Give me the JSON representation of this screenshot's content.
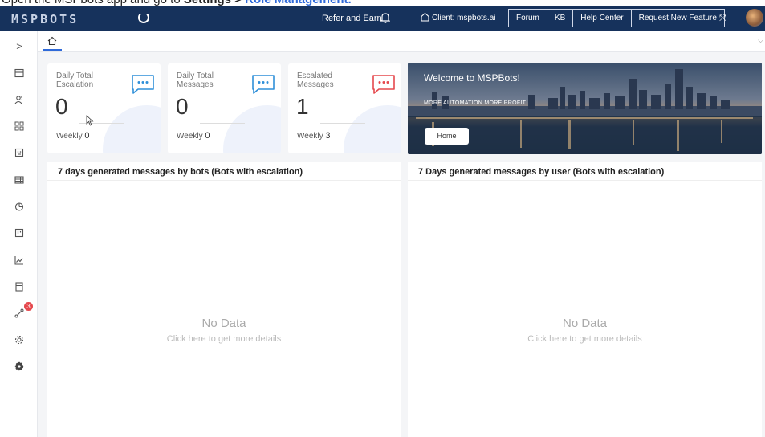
{
  "instruction": {
    "prefix": "Open the MSPbots app and go to ",
    "settings": "Settings",
    "separator": " > ",
    "target": "Role Management."
  },
  "topbar": {
    "logo": "MSPBOTS",
    "refer_label": "Refer and Earn",
    "client_label": "Client: mspbots.ai",
    "nav_buttons": [
      "Forum",
      "KB",
      "Help Center",
      "Request New Feature"
    ]
  },
  "sidebar": {
    "expand_glyph": ">",
    "badge_count": "3"
  },
  "stats": [
    {
      "label": "Daily Total Escalation",
      "value": "0",
      "weekly_label": "Weekly",
      "weekly_value": "0",
      "icon_color": "#2f8fd9"
    },
    {
      "label": "Daily Total Messages",
      "value": "0",
      "weekly_label": "Weekly",
      "weekly_value": "0",
      "icon_color": "#2f8fd9"
    },
    {
      "label": "Escalated Messages",
      "value": "1",
      "weekly_label": "Weekly",
      "weekly_value": "3",
      "icon_color": "#e5484d"
    }
  ],
  "banner": {
    "title": "Welcome to MSPBots!",
    "subtitle": "MORE AUTOMATION MORE PROFIT",
    "home_button": "Home"
  },
  "panels": [
    {
      "title": "7 days generated messages by bots (Bots with escalation)",
      "empty_title": "No Data",
      "empty_sub": "Click here to get more details"
    },
    {
      "title": "7 Days generated messages by user (Bots with escalation)",
      "empty_title": "No Data",
      "empty_sub": "Click here to get more details"
    }
  ]
}
